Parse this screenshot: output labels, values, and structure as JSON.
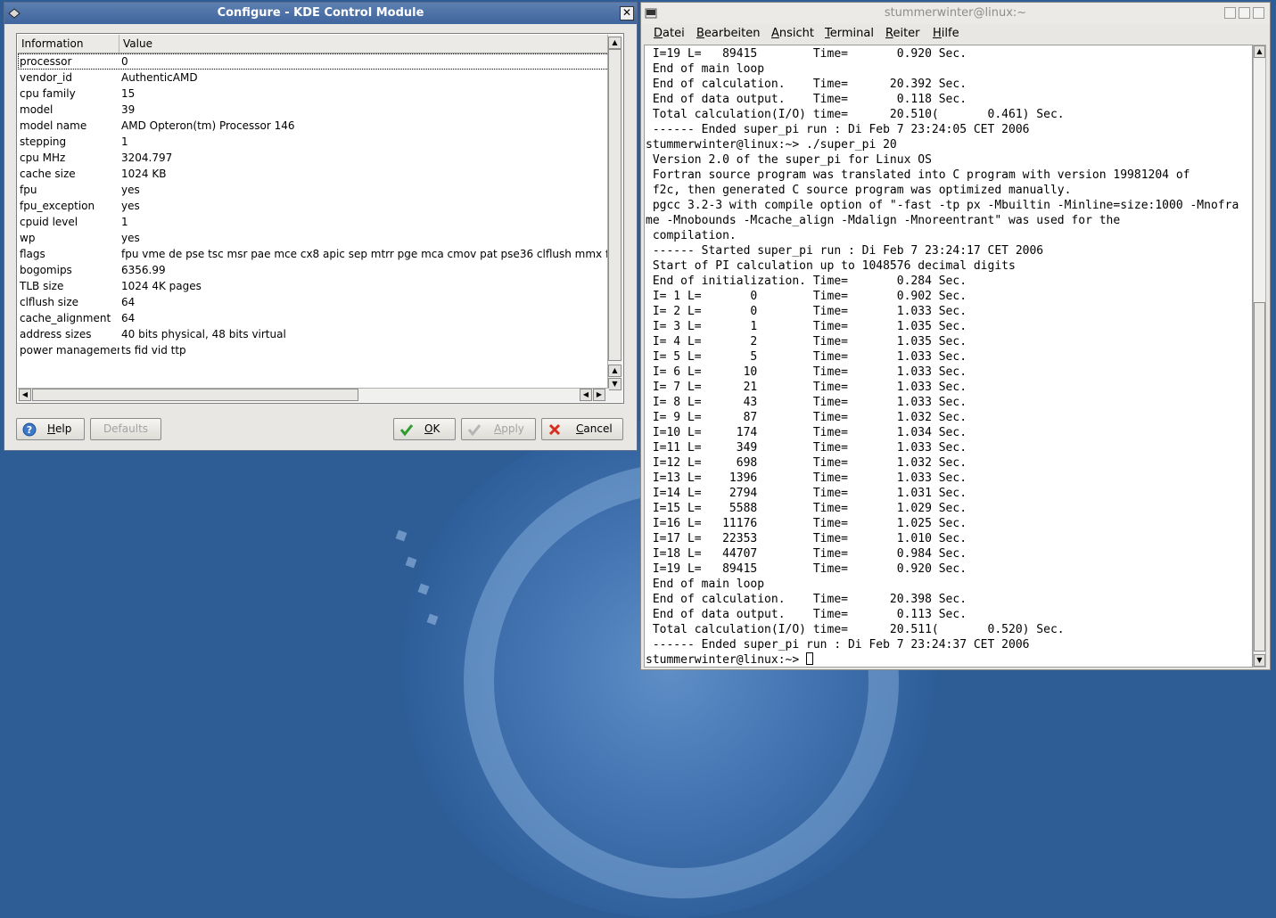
{
  "kcm": {
    "title": "Configure - KDE Control Module",
    "columns": [
      "Information",
      "Value"
    ],
    "rows": [
      {
        "key": "processor",
        "value": "0"
      },
      {
        "key": "vendor_id",
        "value": "AuthenticAMD"
      },
      {
        "key": "cpu family",
        "value": "15"
      },
      {
        "key": "model",
        "value": "39"
      },
      {
        "key": "model name",
        "value": "AMD Opteron(tm) Processor 146"
      },
      {
        "key": "stepping",
        "value": "1"
      },
      {
        "key": "cpu MHz",
        "value": "3204.797"
      },
      {
        "key": "cache size",
        "value": "1024 KB"
      },
      {
        "key": "fpu",
        "value": "yes"
      },
      {
        "key": "fpu_exception",
        "value": "yes"
      },
      {
        "key": "cpuid level",
        "value": "1"
      },
      {
        "key": "wp",
        "value": "yes"
      },
      {
        "key": "flags",
        "value": "fpu vme de pse tsc msr pae mce cx8 apic sep mtrr pge mca cmov pat pse36 clflush mmx fxs"
      },
      {
        "key": "bogomips",
        "value": "6356.99"
      },
      {
        "key": "TLB size",
        "value": "1024 4K pages"
      },
      {
        "key": "clflush size",
        "value": "64"
      },
      {
        "key": "cache_alignment",
        "value": "64"
      },
      {
        "key": "address sizes",
        "value": "40 bits physical, 48 bits virtual"
      },
      {
        "key": "power managemen",
        "value": "ts fid vid ttp"
      }
    ],
    "buttons": {
      "help": "Help",
      "defaults": "Defaults",
      "ok": "OK",
      "apply": "Apply",
      "cancel": "Cancel"
    }
  },
  "konsole": {
    "title": "stummerwinter@linux:~",
    "menu": [
      "Datei",
      "Bearbeiten",
      "Ansicht",
      "Terminal",
      "Reiter",
      "Hilfe"
    ],
    "lines": [
      " I=19 L=   89415        Time=       0.920 Sec.",
      " End of main loop",
      " End of calculation.    Time=      20.392 Sec.",
      " End of data output.    Time=       0.118 Sec.",
      " Total calculation(I/O) time=      20.510(       0.461) Sec.",
      " ------ Ended super_pi run : Di Feb 7 23:24:05 CET 2006",
      "stummerwinter@linux:~> ./super_pi 20",
      " Version 2.0 of the super_pi for Linux OS",
      " Fortran source program was translated into C program with version 19981204 of",
      " f2c, then generated C source program was optimized manually.",
      " pgcc 3.2-3 with compile option of \"-fast -tp px -Mbuiltin -Minline=size:1000 -Mnofra",
      "me -Mnobounds -Mcache_align -Mdalign -Mnoreentrant\" was used for the",
      " compilation.",
      " ------ Started super_pi run : Di Feb 7 23:24:17 CET 2006",
      " Start of PI calculation up to 1048576 decimal digits",
      " End of initialization. Time=       0.284 Sec.",
      " I= 1 L=       0        Time=       0.902 Sec.",
      " I= 2 L=       0        Time=       1.033 Sec.",
      " I= 3 L=       1        Time=       1.035 Sec.",
      " I= 4 L=       2        Time=       1.035 Sec.",
      " I= 5 L=       5        Time=       1.033 Sec.",
      " I= 6 L=      10        Time=       1.033 Sec.",
      " I= 7 L=      21        Time=       1.033 Sec.",
      " I= 8 L=      43        Time=       1.033 Sec.",
      " I= 9 L=      87        Time=       1.032 Sec.",
      " I=10 L=     174        Time=       1.034 Sec.",
      " I=11 L=     349        Time=       1.033 Sec.",
      " I=12 L=     698        Time=       1.032 Sec.",
      " I=13 L=    1396        Time=       1.033 Sec.",
      " I=14 L=    2794        Time=       1.031 Sec.",
      " I=15 L=    5588        Time=       1.029 Sec.",
      " I=16 L=   11176        Time=       1.025 Sec.",
      " I=17 L=   22353        Time=       1.010 Sec.",
      " I=18 L=   44707        Time=       0.984 Sec.",
      " I=19 L=   89415        Time=       0.920 Sec.",
      " End of main loop",
      " End of calculation.    Time=      20.398 Sec.",
      " End of data output.    Time=       0.113 Sec.",
      " Total calculation(I/O) time=      20.511(       0.520) Sec.",
      " ------ Ended super_pi run : Di Feb 7 23:24:37 CET 2006"
    ],
    "prompt": "stummerwinter@linux:~> "
  }
}
